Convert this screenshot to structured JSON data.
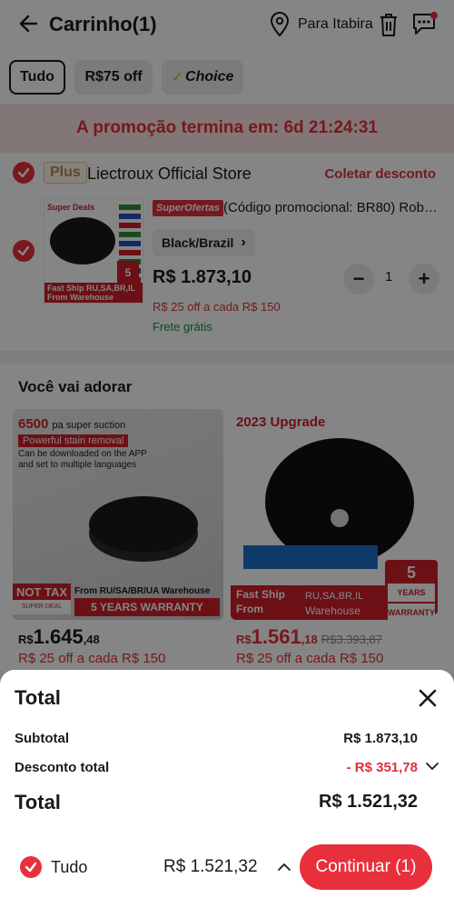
{
  "header": {
    "title": "Carrinho(1)",
    "location": "Para Itabira"
  },
  "tabs": [
    {
      "label": "Tudo",
      "active": true
    },
    {
      "label": "R$75 off",
      "active": false
    },
    {
      "label": "Choice",
      "active": false
    }
  ],
  "promo": {
    "text": "A promoção termina em: 6d 21:24:31"
  },
  "store": {
    "badge": "Plus",
    "name": "Liectroux Official Store",
    "coupon_link": "Coletar desconto"
  },
  "cart_item": {
    "thumb_deal": "Super Deals",
    "thumb_ship": "Fast Ship  RU,SA,BR,IL",
    "thumb_from": "From   Warehouse",
    "thumb_years": "5",
    "sale_badge": "SuperOfertas",
    "title": "(Código promocional: BR80) Robô ...",
    "variant": "Black/Brazil",
    "price": "R$ 1.873,10",
    "discount": "R$ 25 off a cada R$ 150",
    "shipping": "Frete grátis",
    "quantity": "1"
  },
  "recommendations": {
    "title": "Você vai adorar",
    "cards": [
      {
        "hl1_num": "6500",
        "hl1_text": "pa super suction",
        "hl2": "Powerful stain removal",
        "hl3": "Can be downloaded on the APP and set to multiple languages",
        "nottax": "NOT TAX",
        "nottax_small": "SUPER DEAL",
        "from": "From RU/SA/BR/UA Warehouse",
        "warranty": "5 YEARS WARRANTY",
        "currency": "R$",
        "price_int": "1.645",
        "price_cents": ",48",
        "old_price": "",
        "discount": "R$ 25 off a cada R$ 150"
      },
      {
        "upgrade": "2023 Upgrade",
        "fastship": "Fast Ship",
        "from": "From",
        "countries": "RU,SA,BR,IL",
        "warehouse": "Warehouse",
        "years": "5",
        "years_label": "YEARS",
        "warranty_small": "WARRANTY",
        "currency": "R$",
        "price_int": "1.561",
        "price_cents": ",18",
        "old_price": "R$3.393,87",
        "discount": "R$ 25 off a cada R$ 150"
      }
    ]
  },
  "summary": {
    "title": "Total",
    "subtotal_label": "Subtotal",
    "subtotal_value": "R$ 1.873,10",
    "discount_label": "Desconto total",
    "discount_value": "- R$ 351,78",
    "total_label": "Total",
    "total_value": "R$ 1.521,32"
  },
  "bottom_bar": {
    "select_all_label": "Tudo",
    "total": "R$ 1.521,32",
    "continue_label": "Continuar (1)"
  },
  "colors": {
    "accent": "#e8303c",
    "promo_bg": "#fbe3e3",
    "free_shipping": "#1e8a3c"
  }
}
